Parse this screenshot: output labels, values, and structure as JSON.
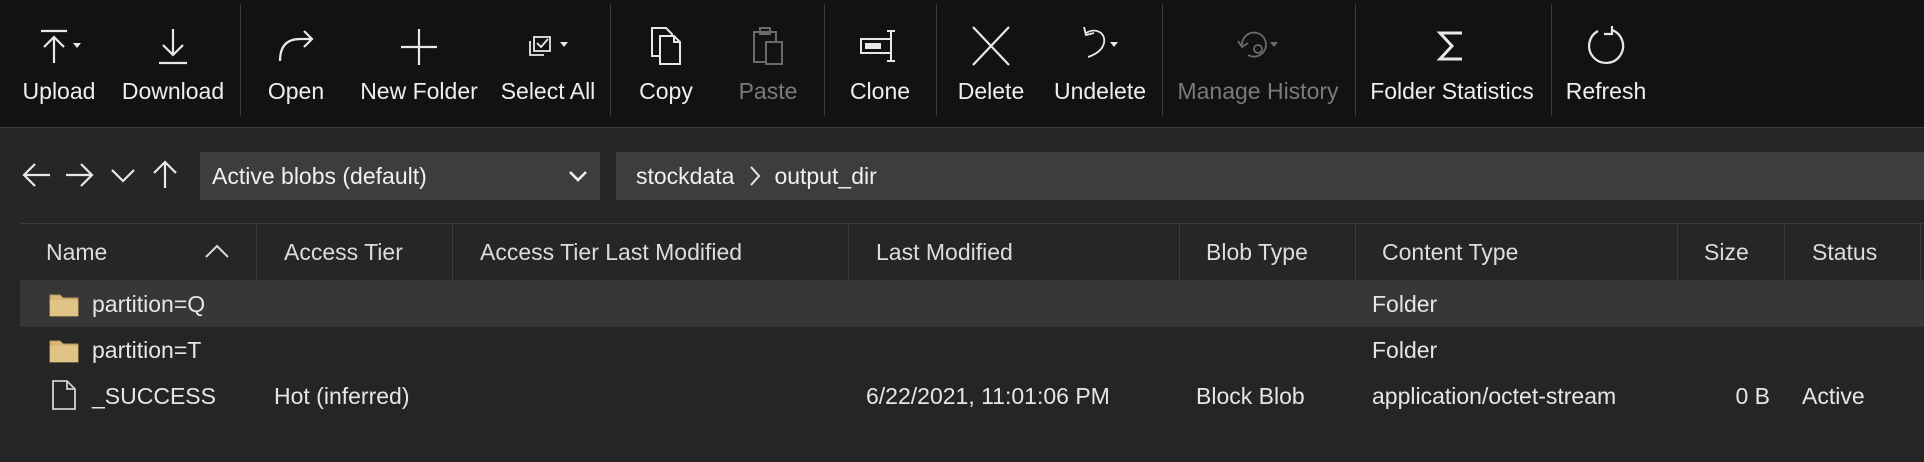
{
  "toolbar": {
    "upload": "Upload",
    "download": "Download",
    "open": "Open",
    "new_folder": "New Folder",
    "select_all": "Select All",
    "copy": "Copy",
    "paste": "Paste",
    "clone": "Clone",
    "delete": "Delete",
    "undelete": "Undelete",
    "manage_history": "Manage History",
    "folder_statistics": "Folder Statistics",
    "refresh": "Refresh"
  },
  "nav": {
    "view_selected": "Active blobs (default)",
    "path": [
      "stockdata",
      "output_dir"
    ]
  },
  "table": {
    "columns": [
      "Name",
      "Access Tier",
      "Access Tier Last Modified",
      "Last Modified",
      "Blob Type",
      "Content Type",
      "Size",
      "Status"
    ],
    "rows": [
      {
        "icon": "folder-icon",
        "name": "partition=Q",
        "access_tier": "",
        "tier_modified": "",
        "last_modified": "",
        "blob_type": "",
        "content_type": "Folder",
        "size": "",
        "status": "",
        "selected": true
      },
      {
        "icon": "folder-icon",
        "name": "partition=T",
        "access_tier": "",
        "tier_modified": "",
        "last_modified": "",
        "blob_type": "",
        "content_type": "Folder",
        "size": "",
        "status": "",
        "selected": false
      },
      {
        "icon": "file-icon",
        "name": "_SUCCESS",
        "access_tier": "Hot (inferred)",
        "tier_modified": "",
        "last_modified": "6/22/2021, 11:01:06 PM",
        "blob_type": "Block Blob",
        "content_type": "application/octet-stream",
        "size": "0 B",
        "status": "Active",
        "selected": false
      }
    ]
  },
  "colors": {
    "toolbar_bg": "#111211",
    "panel_bg": "#252526",
    "selected_row": "#373737",
    "folder": "#d8b77a",
    "disabled_text": "#7a7a7a"
  }
}
